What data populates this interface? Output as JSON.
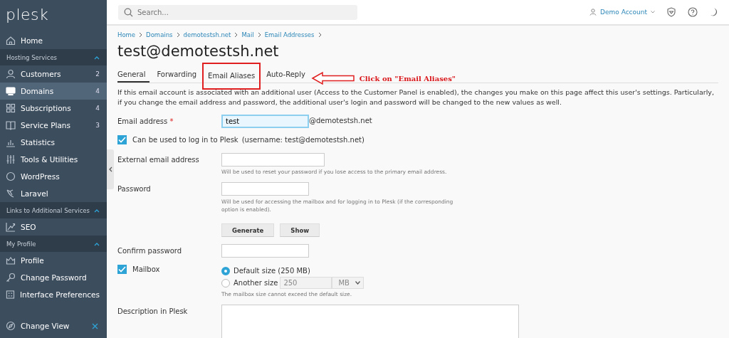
{
  "sidebar": {
    "logo": "plesk",
    "items": [
      {
        "kind": "item",
        "label": "Home",
        "selected": false
      },
      {
        "kind": "section",
        "label": "Hosting Services",
        "expanded": true
      },
      {
        "kind": "item",
        "label": "Customers",
        "count": "2",
        "selected": false
      },
      {
        "kind": "item",
        "label": "Domains",
        "count": "4",
        "selected": true
      },
      {
        "kind": "item",
        "label": "Subscriptions",
        "count": "4",
        "selected": false
      },
      {
        "kind": "item",
        "label": "Service Plans",
        "count": "3",
        "selected": false
      },
      {
        "kind": "item",
        "label": "Statistics",
        "selected": false
      },
      {
        "kind": "item",
        "label": "Tools & Utilities",
        "selected": false
      },
      {
        "kind": "item",
        "label": "WordPress",
        "selected": false
      },
      {
        "kind": "item",
        "label": "Laravel",
        "selected": false
      },
      {
        "kind": "section",
        "label": "Links to Additional Services",
        "expanded": true
      },
      {
        "kind": "item",
        "label": "SEO",
        "selected": false
      },
      {
        "kind": "section",
        "label": "My Profile",
        "expanded": true
      },
      {
        "kind": "item",
        "label": "Profile",
        "selected": false
      },
      {
        "kind": "item",
        "label": "Change Password",
        "selected": false
      },
      {
        "kind": "item",
        "label": "Interface Preferences",
        "selected": false
      }
    ],
    "footer": "Change View"
  },
  "topbar": {
    "search": {
      "placeholder": "Search..."
    },
    "account": "Demo Account"
  },
  "breadcrumbs": [
    "Home",
    "Domains",
    "demotestsh.net",
    "Mail",
    "Email Addresses"
  ],
  "title": "test@demotestsh.net",
  "tabs": [
    {
      "label": "General",
      "selected": true,
      "highlighted": false
    },
    {
      "label": "Forwarding",
      "selected": false,
      "highlighted": false
    },
    {
      "label": "Email Aliases",
      "selected": false,
      "highlighted": true
    },
    {
      "label": "Auto-Reply",
      "selected": false,
      "highlighted": false
    }
  ],
  "annotation": "Click on \"Email Aliases\"",
  "intro": "If this email account is associated with an additional user (Access to the Customer Panel is enabled), the changes you make on this page affect this user's settings. Particularly, if you change the email address and password, the additional user's login and password will be changed to the new values as well.",
  "form": {
    "email": {
      "label": "Email address",
      "required": "*",
      "value": "test",
      "focused": true,
      "suffix": "@demotestsh.net"
    },
    "login": {
      "label": "Can be used to log in to Plesk",
      "note": "(username: test@demotestsh.net)",
      "checked": true
    },
    "external": {
      "label": "External email address",
      "hint": "Will be used to reset your password if you lose access to the primary email address."
    },
    "password": {
      "label": "Password",
      "hint": "Will be used for accessing the mailbox and for logging in to Plesk (if the corresponding option is enabled).",
      "buttons": [
        "Generate",
        "Show"
      ]
    },
    "confirm": {
      "label": "Confirm password"
    },
    "mailbox": {
      "label": "Mailbox",
      "checked": true,
      "options": [
        {
          "label": "Default size (250 MB)",
          "selected": true
        },
        {
          "label": "Another size",
          "selected": false,
          "value": "250",
          "unit": "MB"
        }
      ],
      "hint": "The mailbox size cannot exceed the default size."
    },
    "description": {
      "label": "Description in Plesk"
    }
  }
}
